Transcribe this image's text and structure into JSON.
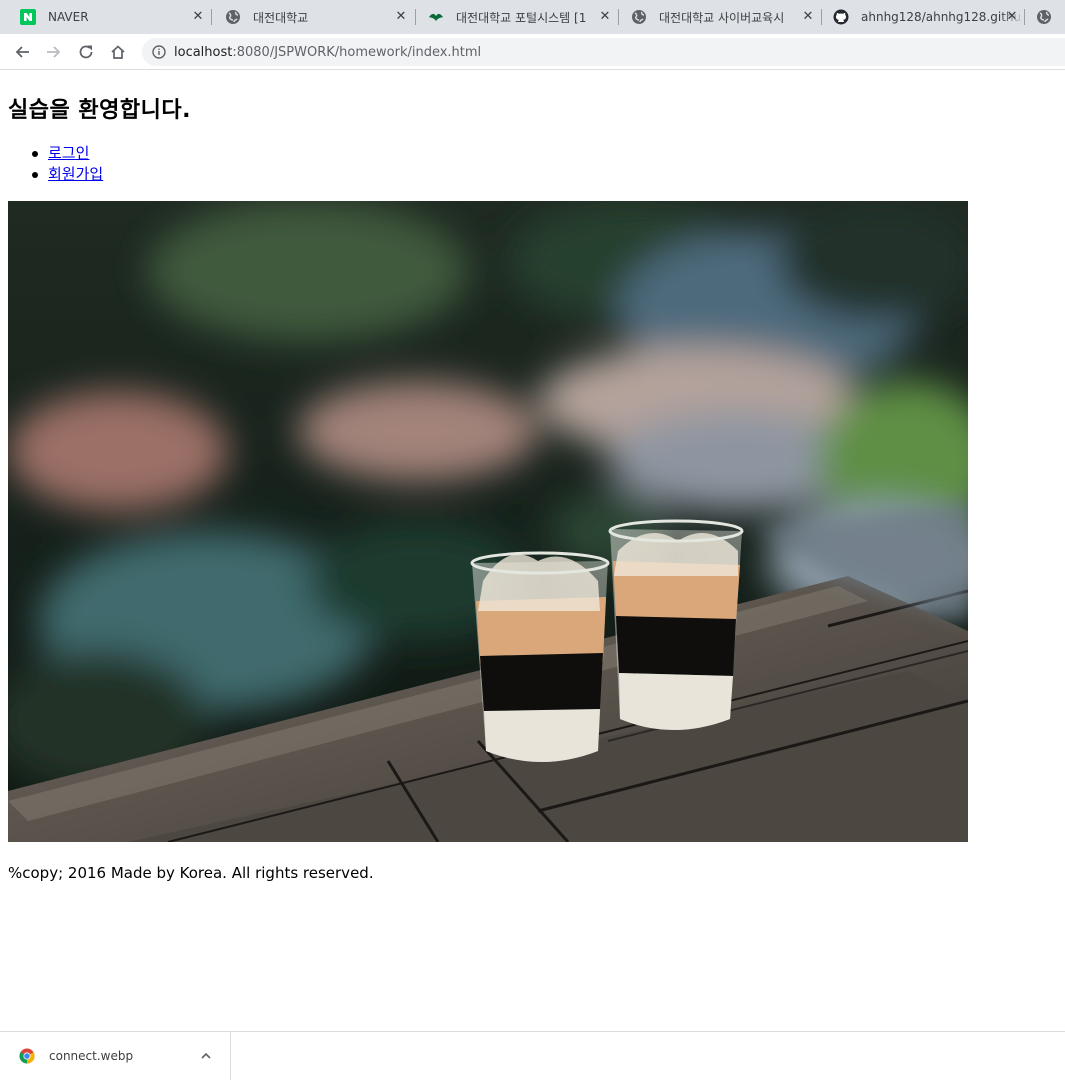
{
  "browser": {
    "tabs": [
      {
        "title": "NAVER",
        "icon": "naver-logo-icon"
      },
      {
        "title": "대전대학교",
        "icon": "globe-icon"
      },
      {
        "title": "대전대학교 포털시스템 [1",
        "icon": "leaf-logo-icon"
      },
      {
        "title": "대전대학교 사이버교육시",
        "icon": "globe-icon"
      },
      {
        "title": "ahnhg128/ahnhg128.githu",
        "icon": "github-icon"
      },
      {
        "title": "",
        "icon": "globe-icon"
      }
    ],
    "url_host": "localhost",
    "url_rest": ":8080/JSPWORK/homework/index.html",
    "accent_colors": {
      "naver": "#03c75a",
      "tabstrip": "#dee1e6",
      "omnibox": "#f1f3f4"
    }
  },
  "page": {
    "heading": "실습을 환영합니다.",
    "links": [
      {
        "label": "로그인"
      },
      {
        "label": "회원가입"
      }
    ],
    "footer": "%copy; 2016 Made by Korea. All rights reserved."
  },
  "downloads": {
    "items": [
      {
        "filename": "connect.webp",
        "icon": "chrome-logo-icon"
      }
    ]
  }
}
